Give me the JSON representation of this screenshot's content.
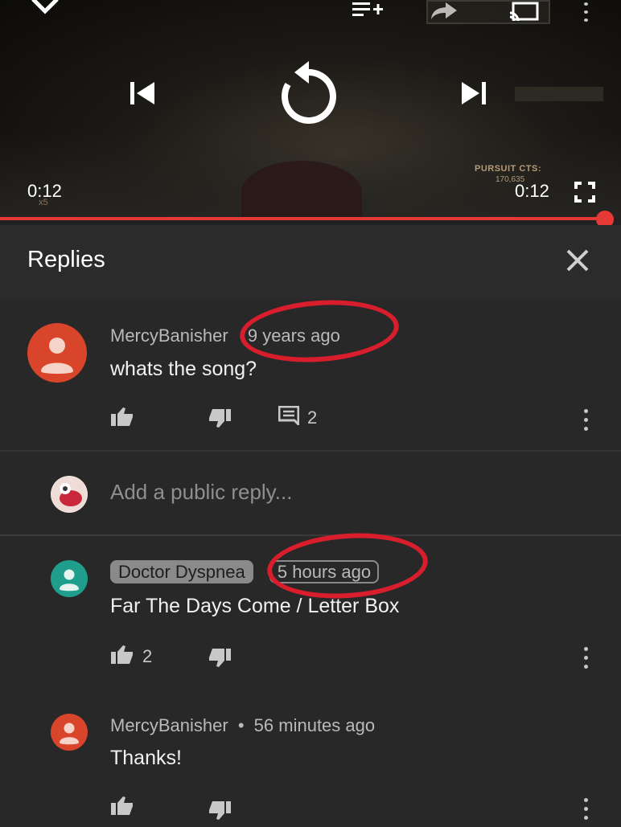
{
  "player": {
    "time_left": "0:12",
    "time_right": "0:12",
    "hud_text": "PURSUIT CTS:",
    "hud_sub": "170,635",
    "hud_multiplier": "x5",
    "progress": 1.0,
    "accent": "#e53935"
  },
  "replies": {
    "title": "Replies"
  },
  "main_comment": {
    "author": "MercyBanisher",
    "time": "9 years ago",
    "text": "whats the song?",
    "reply_count": "2",
    "avatar_color": "#d8452b"
  },
  "reply_input": {
    "placeholder": "Add a public reply..."
  },
  "reply1": {
    "author": "Doctor Dyspnea",
    "time": "5 hours ago",
    "text": "Far The Days Come / Letter Box",
    "like_count": "2",
    "avatar_color": "#1f9e8c"
  },
  "reply2": {
    "author": "MercyBanisher",
    "separator": "•",
    "time": "56 minutes ago",
    "text": "Thanks!",
    "avatar_color": "#d8452b"
  },
  "icons": [
    "chevron-down-icon",
    "add-to-queue-icon",
    "share-icon",
    "cast-icon",
    "more-vert-icon",
    "skip-previous-icon",
    "replay-icon",
    "skip-next-icon",
    "fullscreen-icon",
    "close-icon",
    "thumb-up-icon",
    "thumb-down-icon",
    "comment-icon"
  ],
  "annotation_color": "#d81e2c"
}
